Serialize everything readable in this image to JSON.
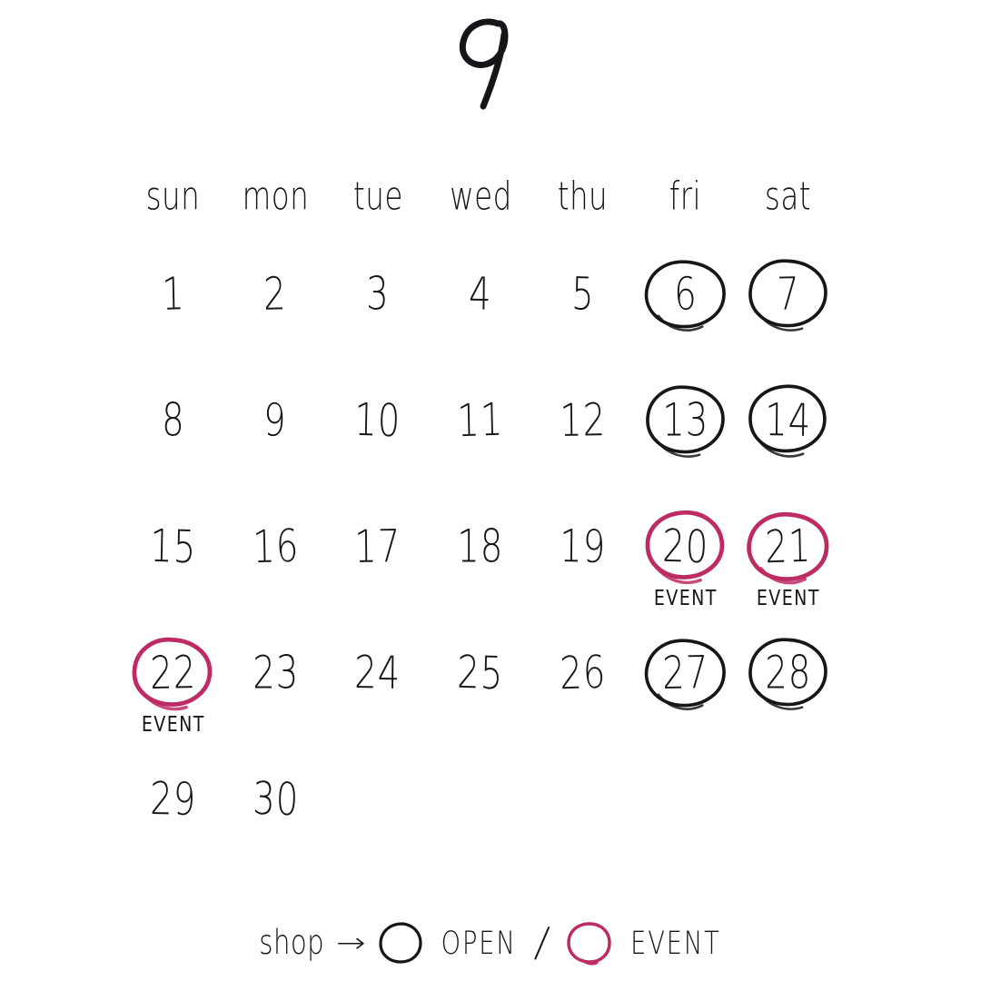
{
  "calendar": {
    "month_title": "9",
    "weekdays": [
      "sun",
      "mon",
      "tue",
      "wed",
      "thu",
      "fri",
      "sat"
    ],
    "start_weekday_index": 0,
    "days_in_month": 30,
    "event_label": "EVENT",
    "days": [
      {
        "num": "1",
        "mark": "none"
      },
      {
        "num": "2",
        "mark": "none"
      },
      {
        "num": "3",
        "mark": "none"
      },
      {
        "num": "4",
        "mark": "none"
      },
      {
        "num": "5",
        "mark": "none"
      },
      {
        "num": "6",
        "mark": "open"
      },
      {
        "num": "7",
        "mark": "open"
      },
      {
        "num": "8",
        "mark": "none"
      },
      {
        "num": "9",
        "mark": "none"
      },
      {
        "num": "10",
        "mark": "none"
      },
      {
        "num": "11",
        "mark": "none"
      },
      {
        "num": "12",
        "mark": "none"
      },
      {
        "num": "13",
        "mark": "open"
      },
      {
        "num": "14",
        "mark": "open"
      },
      {
        "num": "15",
        "mark": "none"
      },
      {
        "num": "16",
        "mark": "none"
      },
      {
        "num": "17",
        "mark": "none"
      },
      {
        "num": "18",
        "mark": "none"
      },
      {
        "num": "19",
        "mark": "none"
      },
      {
        "num": "20",
        "mark": "event",
        "note": "EVENT"
      },
      {
        "num": "21",
        "mark": "event",
        "note": "EVENT"
      },
      {
        "num": "22",
        "mark": "event",
        "note": "EVENT"
      },
      {
        "num": "23",
        "mark": "none"
      },
      {
        "num": "24",
        "mark": "none"
      },
      {
        "num": "25",
        "mark": "none"
      },
      {
        "num": "26",
        "mark": "none"
      },
      {
        "num": "27",
        "mark": "open"
      },
      {
        "num": "28",
        "mark": "open"
      },
      {
        "num": "29",
        "mark": "none"
      },
      {
        "num": "30",
        "mark": "none"
      }
    ]
  },
  "legend": {
    "prefix": "shop",
    "arrow": "→",
    "open_label": "OPEN",
    "separator": "/",
    "event_label": "EVENT",
    "open_icon": "hand-drawn-circle-black",
    "event_icon": "hand-drawn-circle-pink"
  },
  "colors": {
    "ink": "#16161a",
    "event_pink": "#be2a63",
    "background": "#ffffff"
  }
}
